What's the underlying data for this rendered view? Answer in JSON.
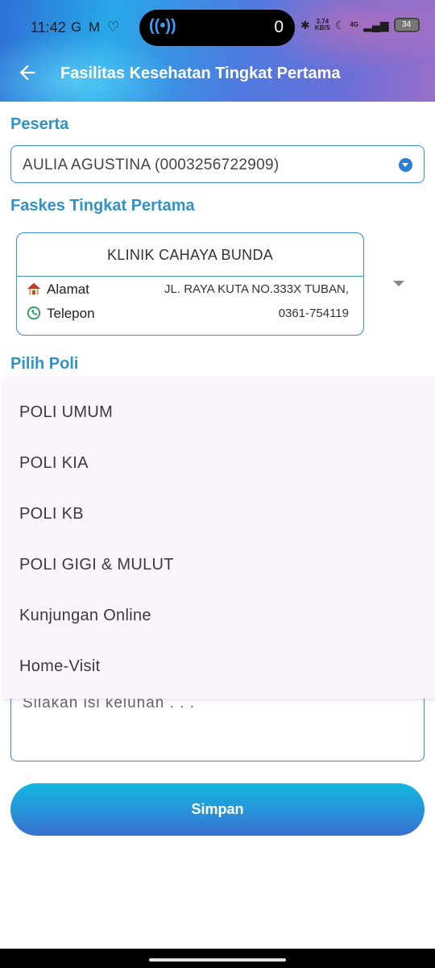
{
  "status_bar": {
    "time": "11:42",
    "left_icons": "G M ♡",
    "pill_count": "0",
    "net_speed_top": "3.74",
    "net_speed_bottom": "KB/S",
    "network": "4G",
    "battery": "34"
  },
  "app_bar": {
    "title": "Fasilitas Kesehatan Tingkat Pertama"
  },
  "peserta": {
    "label": "Peserta",
    "selected": "AULIA AGUSTINA (0003256722909)"
  },
  "faskes": {
    "label": "Faskes Tingkat Pertama",
    "name": "KLINIK CAHAYA BUNDA",
    "address_label": "Alamat",
    "address_value": "JL. RAYA KUTA NO.333X TUBAN,",
    "phone_label": "Telepon",
    "phone_value": "0361-754119"
  },
  "poli": {
    "label": "Pilih Poli",
    "options": [
      "POLI UMUM",
      "POLI KIA",
      "POLI KB",
      "POLI GIGI & MULUT",
      "Kunjungan Online",
      "Home-Visit"
    ]
  },
  "keluhan": {
    "placeholder": "Silakan isi keluhan . . ."
  },
  "actions": {
    "save_label": "Simpan"
  },
  "colors": {
    "accent": "#2f92c8",
    "border": "#3a8ed0",
    "dropdown_bg": "#fcf4fc"
  }
}
